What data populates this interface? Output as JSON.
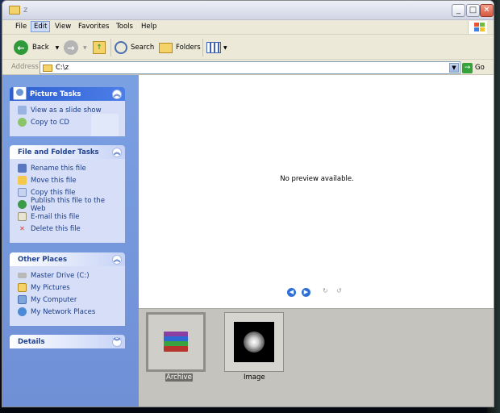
{
  "window": {
    "title": "z"
  },
  "menu": [
    "File",
    "Edit",
    "View",
    "Favorites",
    "Tools",
    "Help"
  ],
  "menu_active": "Edit",
  "toolbar": {
    "back": "Back",
    "search": "Search",
    "folders": "Folders"
  },
  "address": {
    "label": "Address",
    "value": "C:\\z",
    "go": "Go"
  },
  "picture_tasks": {
    "title": "Picture Tasks",
    "items": [
      "View as a slide show",
      "Copy to CD"
    ]
  },
  "file_tasks": {
    "title": "File and Folder Tasks",
    "items": [
      "Rename this file",
      "Move this file",
      "Copy this file",
      "Publish this file to the Web",
      "E-mail this file",
      "Delete this file"
    ]
  },
  "other_places": {
    "title": "Other Places",
    "items": [
      "Master Drive (C:)",
      "My Pictures",
      "My Computer",
      "My Network Places"
    ]
  },
  "details": {
    "title": "Details"
  },
  "preview": {
    "message": "No preview available."
  },
  "filmstrip": {
    "items": [
      "Archive",
      "Image"
    ],
    "selected": "Archive"
  },
  "colors": {
    "task_pane": "#7ba0e2",
    "panel_body": "#d6dff7",
    "header_blue": "#2e5fd0",
    "filmstrip": "#c4c3be"
  }
}
